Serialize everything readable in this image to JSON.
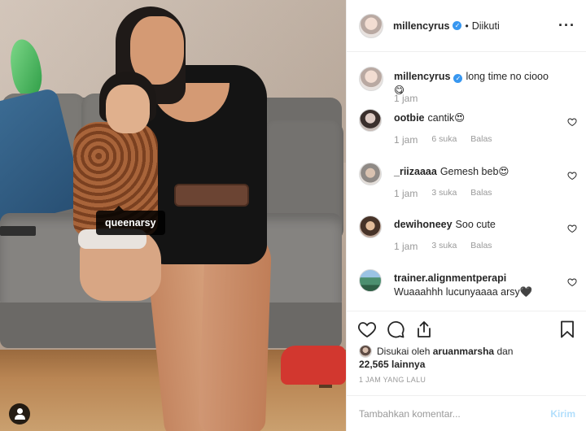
{
  "photo": {
    "tagged_user": "queenarsy",
    "user_tag_icon": "user-silhouette-icon"
  },
  "header": {
    "username": "millencyrus",
    "verified_icon": "verified-badge-icon",
    "separator": "•",
    "follow_status": "Diikuti",
    "more_icon": "ellipsis-icon"
  },
  "caption": {
    "username": "millencyrus",
    "text": "long time no ciooo😋",
    "time": "1 jam"
  },
  "comments": [
    {
      "username": "ootbie",
      "text": "cantik😍",
      "time": "1 jam",
      "likes": "6 suka",
      "reply": "Balas"
    },
    {
      "username": "_riizaaaa",
      "text": "Gemesh beb😍",
      "time": "1 jam",
      "likes": "3 suka",
      "reply": "Balas"
    },
    {
      "username": "dewihoneey",
      "text": "Soo cute",
      "time": "1 jam",
      "likes": "3 suka",
      "reply": "Balas"
    },
    {
      "username": "trainer.alignmentperapi",
      "text": "Wuaaahhh lucunyaaaa arsy🖤",
      "time": "",
      "likes": "",
      "reply": ""
    }
  ],
  "likes": {
    "prefix": "Disukai oleh",
    "liker": "aruanmarsha",
    "conjunction": "dan",
    "others": "22,565 lainnya"
  },
  "posted": "1 JAM YANG LALU",
  "composer": {
    "placeholder": "Tambahkan komentar...",
    "send_label": "Kirim"
  },
  "colors": {
    "accent": "#3897f0",
    "text": "#262626",
    "muted": "#999999",
    "send_disabled": "#b2dffc"
  }
}
